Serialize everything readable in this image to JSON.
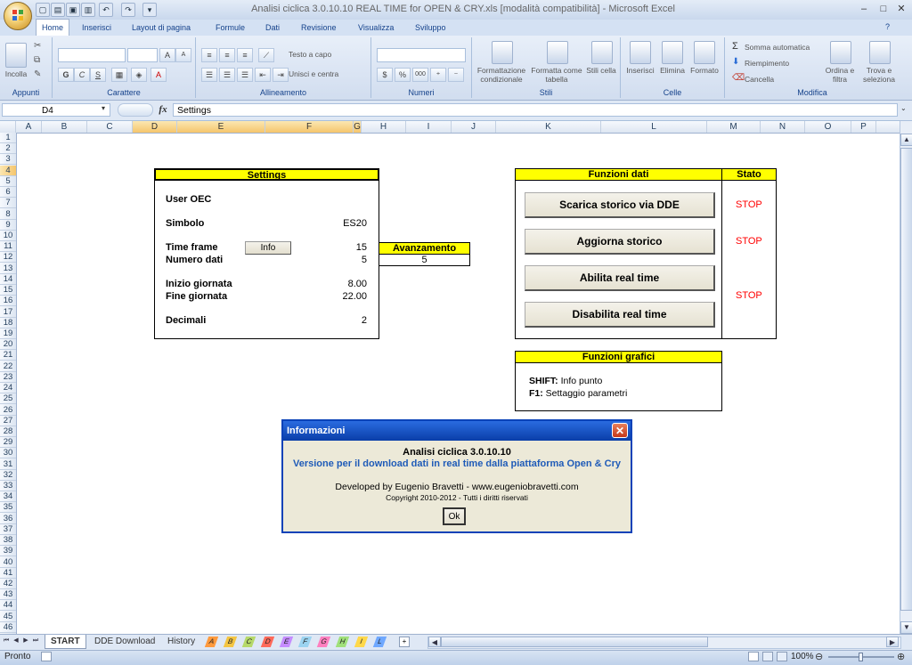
{
  "window": {
    "title": "Analisi ciclica 3.0.10.10 REAL TIME for OPEN & CRY.xls  [modalità compatibilità] - Microsoft Excel",
    "minimize": "–",
    "maximize": "□",
    "close": "✕"
  },
  "quick_access": {
    "undo": "↶",
    "redo": "↷"
  },
  "ribbon": {
    "tabs": [
      "Home",
      "Inserisci",
      "Layout di pagina",
      "Formule",
      "Dati",
      "Revisione",
      "Visualizza",
      "Sviluppo"
    ],
    "groups": {
      "appunti": {
        "label": "Appunti",
        "paste": "Incolla"
      },
      "carattere": {
        "label": "Carattere",
        "grow": "A",
        "shrink": "A",
        "bold": "G",
        "italic": "C",
        "underline": "S"
      },
      "allineamento": {
        "label": "Allineamento",
        "wrap": "Testo a capo",
        "merge": "Unisci e centra"
      },
      "numeri": {
        "label": "Numeri",
        "percent": "%",
        "thousands": "000"
      },
      "stili": {
        "label": "Stili",
        "cond": "Formattazione condizionale",
        "table": "Formatta come tabella",
        "cell": "Stili cella"
      },
      "celle": {
        "label": "Celle",
        "insert": "Inserisci",
        "delete": "Elimina",
        "format": "Formato"
      },
      "modifica": {
        "label": "Modifica",
        "autosum": "Somma automatica",
        "fill": "Riempimento",
        "clear": "Cancella",
        "sort": "Ordina e filtra",
        "find": "Trova e seleziona"
      }
    }
  },
  "formula_bar": {
    "cell_ref": "D4",
    "fx": "fx",
    "content": "Settings"
  },
  "columns": [
    "A",
    "B",
    "C",
    "D",
    "E",
    "F",
    "G",
    "H",
    "I",
    "J",
    "K",
    "L",
    "M",
    "N",
    "O",
    "P"
  ],
  "selected_columns": [
    "D",
    "E",
    "F",
    "G"
  ],
  "rows": [
    "1",
    "2",
    "3",
    "4",
    "5",
    "6",
    "7",
    "8",
    "9",
    "10",
    "11",
    "12",
    "13",
    "14",
    "15",
    "16",
    "17",
    "18",
    "19",
    "20",
    "21",
    "22",
    "23",
    "24",
    "25",
    "26",
    "27",
    "28",
    "29",
    "30",
    "31",
    "32",
    "33",
    "34",
    "35",
    "36",
    "37",
    "38",
    "39",
    "40",
    "41",
    "42",
    "43",
    "44",
    "45",
    "46"
  ],
  "settings": {
    "title": "Settings",
    "user_label": "User OEC",
    "symbol_label": "Simbolo",
    "symbol_value": "ES20",
    "timeframe_label": "Time frame",
    "timeframe_value": "15",
    "info_button": "Info",
    "numdata_label": "Numero dati",
    "numdata_value": "5",
    "start_label": "Inizio giornata",
    "start_value": "8.00",
    "end_label": "Fine giornata",
    "end_value": "22.00",
    "decimals_label": "Decimali",
    "decimals_value": "2"
  },
  "progress": {
    "title": "Avanzamento",
    "value": "5"
  },
  "data_functions": {
    "title": "Funzioni dati",
    "status_title": "Stato",
    "btn_download": "Scarica storico via DDE",
    "status_download": "STOP",
    "btn_update": "Aggiorna storico",
    "status_update": "STOP",
    "btn_enable": "Abilita real time",
    "btn_disable": "Disabilita real time",
    "status_realtime": "STOP"
  },
  "chart_functions": {
    "title": "Funzioni grafici",
    "shift_key": "SHIFT:",
    "shift_desc": "Info punto",
    "f1_key": "F1:",
    "f1_desc": "Settaggio parametri"
  },
  "dialog": {
    "title": "Informazioni",
    "heading": "Analisi ciclica 3.0.10.10",
    "subtitle": "Versione per il download dati in real time dalla piattaforma Open & Cry",
    "developer": "Developed by Eugenio Bravetti - www.eugeniobravetti.com",
    "copyright": "Copyright 2010-2012 - Tutti i diritti riservati",
    "ok": "Ok"
  },
  "sheets": {
    "active": "START",
    "others": [
      "DDE Download",
      "History"
    ],
    "color_tabs": [
      "A",
      "B",
      "C",
      "D",
      "E",
      "F",
      "G",
      "H",
      "I",
      "L"
    ]
  },
  "status": {
    "ready": "Pronto",
    "zoom": "100%"
  },
  "colors": {
    "yellow_header": "#ffff00",
    "stop_red": "#ff0000",
    "dialog_title_blue": "#0a3ea8",
    "subtitle_blue": "#1f5bb8"
  }
}
